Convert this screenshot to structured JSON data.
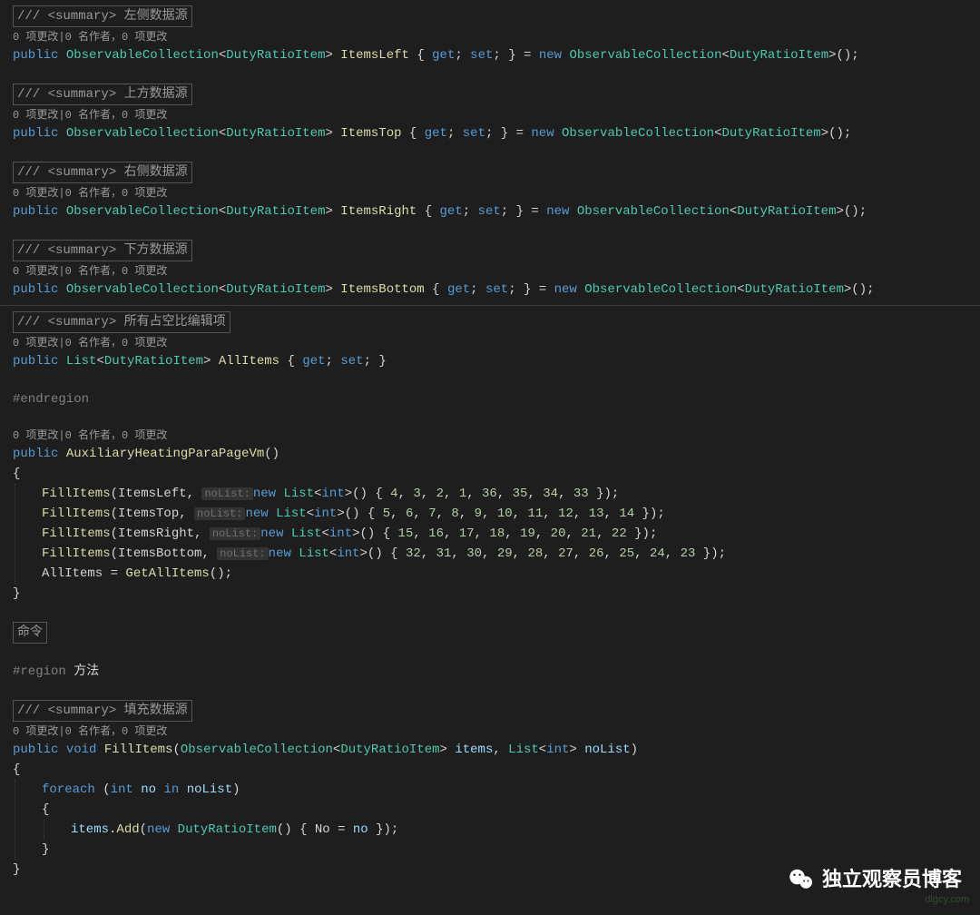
{
  "blocks": {
    "left": {
      "summary": "/// <summary> 左侧数据源",
      "codelens": "0 项更改|0 名作者，0 项更改",
      "prop": "ItemsLeft"
    },
    "top": {
      "summary": "/// <summary> 上方数据源",
      "codelens": "0 项更改|0 名作者，0 项更改",
      "prop": "ItemsTop"
    },
    "right": {
      "summary": "/// <summary> 右侧数据源",
      "codelens": "0 项更改|0 名作者，0 项更改",
      "prop": "ItemsRight"
    },
    "bottom": {
      "summary": "/// <summary> 下方数据源",
      "codelens": "0 项更改|0 名作者，0 项更改",
      "prop": "ItemsBottom"
    },
    "all": {
      "summary": "/// <summary> 所有占空比编辑项",
      "codelens": "0 项更改|0 名作者，0 项更改",
      "prop": "AllItems",
      "type": "List<DutyRatioItem>"
    },
    "fill": {
      "summary": "/// <summary> 填充数据源",
      "codelens": "0 项更改|0 名作者，0 项更改"
    }
  },
  "common": {
    "public": "public",
    "new": "new",
    "get": "get",
    "set": "set",
    "void": "void",
    "int": "int",
    "foreach": "foreach",
    "in": "in",
    "observable": "ObservableCollection",
    "duty": "DutyRatioItem",
    "list": "List",
    "hint": "noList:"
  },
  "ctor": {
    "codelens": "0 项更改|0 名作者，0 项更改",
    "name": "AuxiliaryHeatingParaPageVm",
    "lines": {
      "l1": "FillItems(ItemsLeft, ",
      "l1b": "new List<int>() { 4, 3, 2, 1, 36, 35, 34, 33 });",
      "l2": "FillItems(ItemsTop,  ",
      "l2b": "new List<int>() { 5, 6, 7, 8, 9, 10, 11, 12, 13, 14 });",
      "l3": "FillItems(ItemsRight, ",
      "l3b": "new List<int>() { 15, 16, 17, 18, 19, 20, 21, 22 });",
      "l4": "FillItems(ItemsBottom, ",
      "l4b": "new List<int>() { 32, 31, 30, 29, 28, 27, 26, 25, 24, 23 });",
      "l5": "AllItems = GetAllItems();"
    }
  },
  "endregion": "#endregion",
  "region_method": "#region",
  "region_method_txt": " 方法",
  "cmd_box": "命令",
  "fill_method": {
    "name": "FillItems",
    "param_items": "items",
    "param_nolist": "noList",
    "loopvar": "no",
    "addline_a": "items.Add(",
    "addline_b": " DutyRatioItem() { No = no });"
  },
  "watermark": "独立观察员博客",
  "dlgcy": "dlgcy.com"
}
